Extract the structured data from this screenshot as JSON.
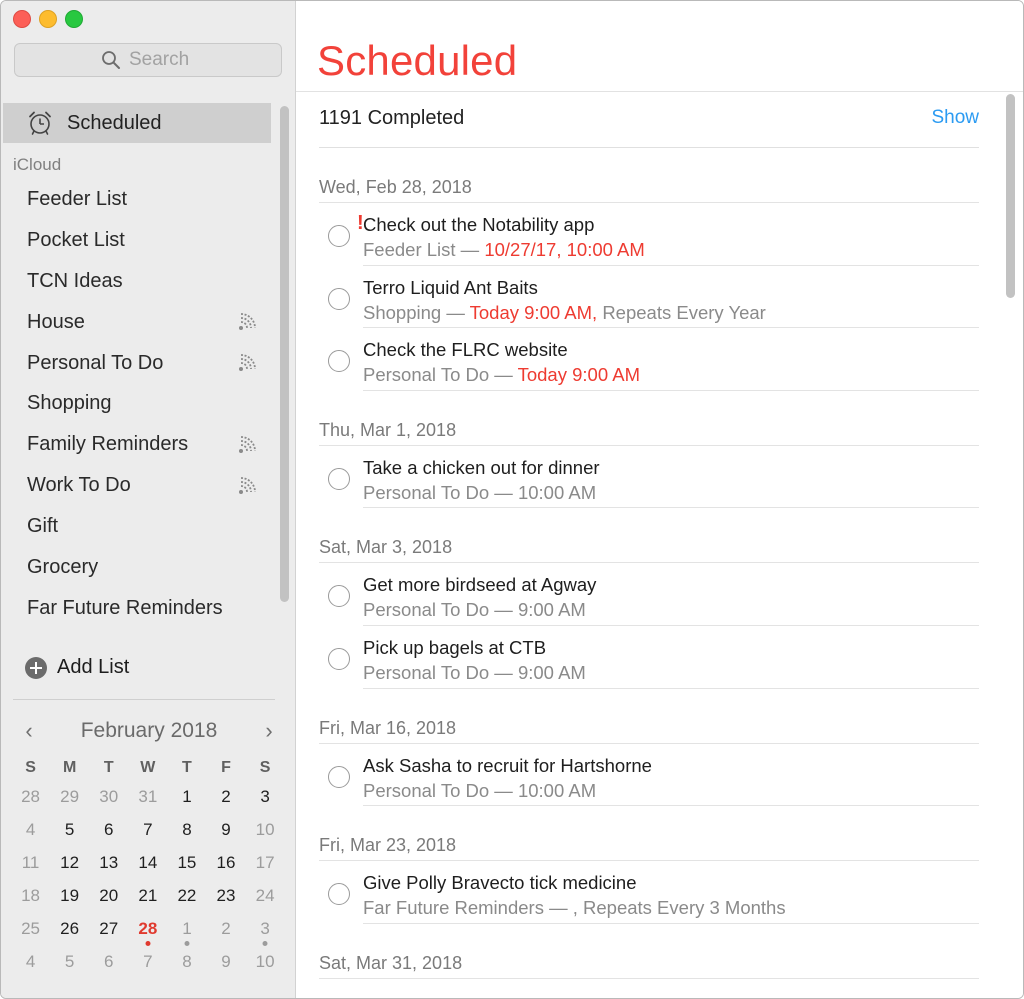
{
  "sidebar": {
    "search_placeholder": "Search",
    "scheduled_label": "Scheduled",
    "group_label": "iCloud",
    "lists": [
      {
        "name": "Feeder List",
        "shared": false
      },
      {
        "name": "Pocket List",
        "shared": false
      },
      {
        "name": "TCN Ideas",
        "shared": false
      },
      {
        "name": "House",
        "shared": true
      },
      {
        "name": "Personal To Do",
        "shared": true
      },
      {
        "name": "Shopping",
        "shared": false
      },
      {
        "name": "Family Reminders",
        "shared": true
      },
      {
        "name": "Work To Do",
        "shared": true
      },
      {
        "name": "Gift",
        "shared": false
      },
      {
        "name": "Grocery",
        "shared": false
      },
      {
        "name": "Far Future Reminders",
        "shared": false
      }
    ],
    "add_list_label": "Add List"
  },
  "calendar": {
    "title": "February 2018",
    "prev": "‹",
    "next": "›",
    "weekdays": [
      "S",
      "M",
      "T",
      "W",
      "T",
      "F",
      "S"
    ],
    "weeks": [
      [
        {
          "d": "28",
          "o": true
        },
        {
          "d": "29",
          "o": true
        },
        {
          "d": "30",
          "o": true
        },
        {
          "d": "31",
          "o": true
        },
        {
          "d": "1"
        },
        {
          "d": "2"
        },
        {
          "d": "3"
        }
      ],
      [
        {
          "d": "4",
          "o": true
        },
        {
          "d": "5"
        },
        {
          "d": "6"
        },
        {
          "d": "7"
        },
        {
          "d": "8"
        },
        {
          "d": "9"
        },
        {
          "d": "10",
          "o": true
        }
      ],
      [
        {
          "d": "11",
          "o": true
        },
        {
          "d": "12"
        },
        {
          "d": "13"
        },
        {
          "d": "14"
        },
        {
          "d": "15"
        },
        {
          "d": "16"
        },
        {
          "d": "17",
          "o": true
        }
      ],
      [
        {
          "d": "18",
          "o": true
        },
        {
          "d": "19"
        },
        {
          "d": "20"
        },
        {
          "d": "21"
        },
        {
          "d": "22"
        },
        {
          "d": "23"
        },
        {
          "d": "24",
          "o": true
        }
      ],
      [
        {
          "d": "25",
          "o": true
        },
        {
          "d": "26"
        },
        {
          "d": "27"
        },
        {
          "d": "28",
          "today": true,
          "dot": "red"
        },
        {
          "d": "1",
          "o": true,
          "dot": "grey"
        },
        {
          "d": "2",
          "o": true
        },
        {
          "d": "3",
          "o": true,
          "dot": "grey"
        }
      ],
      [
        {
          "d": "4",
          "o": true
        },
        {
          "d": "5",
          "o": true
        },
        {
          "d": "6",
          "o": true
        },
        {
          "d": "7",
          "o": true
        },
        {
          "d": "8",
          "o": true
        },
        {
          "d": "9",
          "o": true
        },
        {
          "d": "10",
          "o": true
        }
      ]
    ],
    "colors": {
      "today": "#e03a2f",
      "muted": "#9c9c9c"
    }
  },
  "main": {
    "title": "Scheduled",
    "completed_count": "1191",
    "completed_label": "Completed",
    "show_label": "Show",
    "accent_color": "#f2423a",
    "sections": [
      {
        "date": "Wed, Feb 28, 2018",
        "items": [
          {
            "title": "Check out the Notability app",
            "priority": "!",
            "list": "Feeder List —",
            "due": "10/27/17, 10:00 AM",
            "due_red": true,
            "repeat": ""
          },
          {
            "title": "Terro Liquid Ant Baits",
            "list": "Shopping —",
            "due": "Today 9:00 AM,",
            "due_red": true,
            "repeat": "Repeats Every Year"
          },
          {
            "title": "Check the FLRC website",
            "list": "Personal To Do —",
            "due": "Today 9:00 AM",
            "due_red": true,
            "repeat": ""
          }
        ]
      },
      {
        "date": "Thu, Mar 1, 2018",
        "items": [
          {
            "title": "Take a chicken out for dinner",
            "list": "Personal To Do —",
            "due": "10:00 AM",
            "due_red": false,
            "repeat": ""
          }
        ]
      },
      {
        "date": "Sat, Mar 3, 2018",
        "items": [
          {
            "title": "Get more birdseed at Agway",
            "list": "Personal To Do —",
            "due": "9:00 AM",
            "due_red": false,
            "repeat": ""
          },
          {
            "title": "Pick up bagels at CTB",
            "list": "Personal To Do —",
            "due": "9:00 AM",
            "due_red": false,
            "repeat": ""
          }
        ]
      },
      {
        "date": "Fri, Mar 16, 2018",
        "items": [
          {
            "title": "Ask Sasha to recruit for Hartshorne",
            "list": "Personal To Do —",
            "due": "10:00 AM",
            "due_red": false,
            "repeat": ""
          }
        ]
      },
      {
        "date": "Fri, Mar 23, 2018",
        "items": [
          {
            "title": "Give Polly Bravecto tick medicine",
            "list": "Far Future Reminders —",
            "due": ",",
            "due_red": false,
            "repeat": "Repeats Every 3 Months"
          }
        ]
      },
      {
        "date": "Sat, Mar 31, 2018",
        "items": []
      }
    ]
  },
  "icons": {
    "search": "search-icon",
    "scheduled": "alarm-clock-icon",
    "shared": "shared-broadcast-icon",
    "add": "plus-circle-icon"
  }
}
